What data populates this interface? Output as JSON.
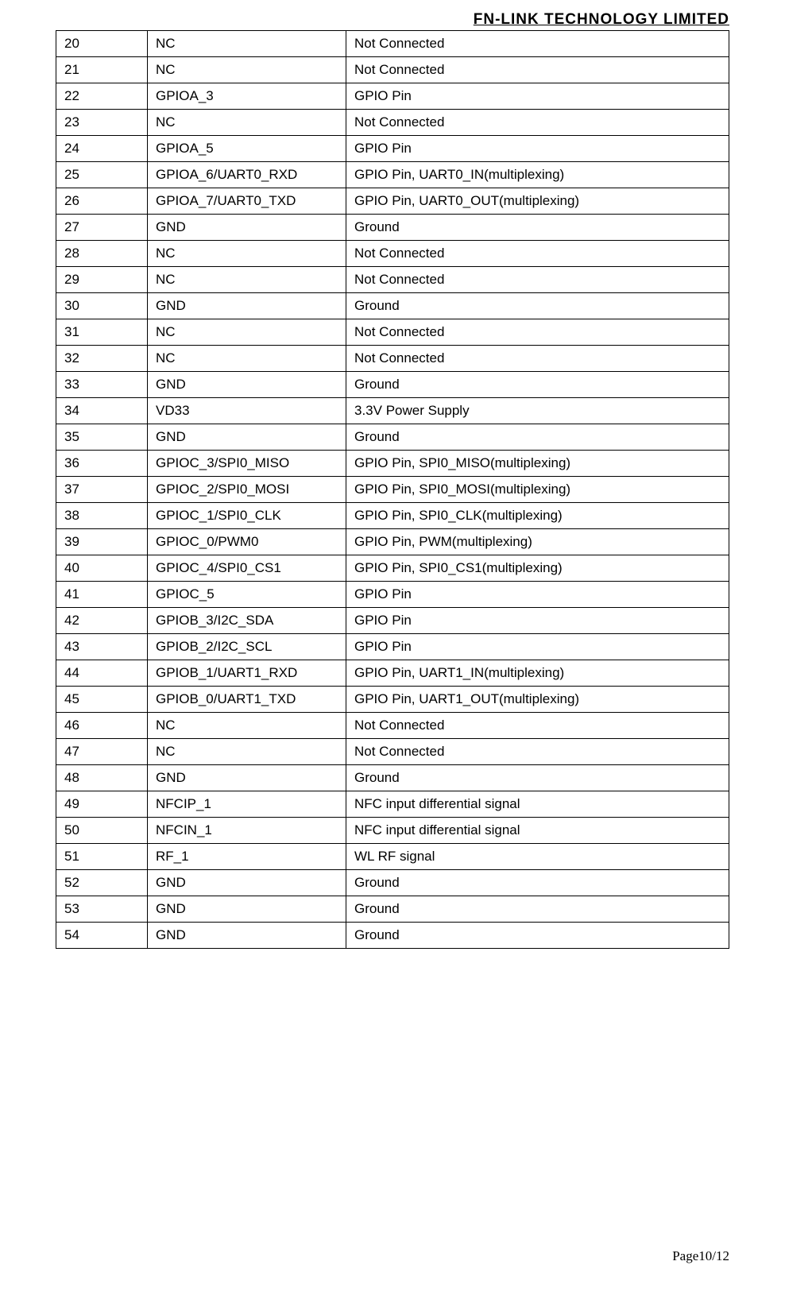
{
  "header": {
    "company": "FN-LINK TECHNOLOGY LIMITED"
  },
  "table": {
    "rows": [
      {
        "num": "20",
        "name": "NC",
        "desc": "Not Connected"
      },
      {
        "num": "21",
        "name": "NC",
        "desc": "Not Connected"
      },
      {
        "num": "22",
        "name": "GPIOA_3",
        "desc": "GPIO Pin"
      },
      {
        "num": "23",
        "name": "NC",
        "desc": "Not Connected"
      },
      {
        "num": "24",
        "name": "GPIOA_5",
        "desc": "GPIO Pin"
      },
      {
        "num": "25",
        "name": "GPIOA_6/UART0_RXD",
        "desc": "GPIO Pin, UART0_IN(multiplexing)"
      },
      {
        "num": "26",
        "name": "GPIOA_7/UART0_TXD",
        "desc": "GPIO Pin, UART0_OUT(multiplexing)"
      },
      {
        "num": "27",
        "name": "GND",
        "desc": "Ground"
      },
      {
        "num": "28",
        "name": "NC",
        "desc": "Not Connected"
      },
      {
        "num": "29",
        "name": "NC",
        "desc": "Not Connected"
      },
      {
        "num": "30",
        "name": "GND",
        "desc": "Ground"
      },
      {
        "num": "31",
        "name": "NC",
        "desc": "Not Connected"
      },
      {
        "num": "32",
        "name": "NC",
        "desc": "Not Connected"
      },
      {
        "num": "33",
        "name": "GND",
        "desc": "Ground"
      },
      {
        "num": "34",
        "name": "VD33",
        "desc": "3.3V Power Supply"
      },
      {
        "num": "35",
        "name": "GND",
        "desc": "Ground"
      },
      {
        "num": "36",
        "name": "GPIOC_3/SPI0_MISO",
        "desc": "GPIO Pin, SPI0_MISO(multiplexing)"
      },
      {
        "num": "37",
        "name": "GPIOC_2/SPI0_MOSI",
        "desc": "GPIO Pin, SPI0_MOSI(multiplexing)"
      },
      {
        "num": "38",
        "name": "GPIOC_1/SPI0_CLK",
        "desc": "GPIO Pin, SPI0_CLK(multiplexing)"
      },
      {
        "num": "39",
        "name": "GPIOC_0/PWM0",
        "desc": "GPIO Pin, PWM(multiplexing)"
      },
      {
        "num": "40",
        "name": "GPIOC_4/SPI0_CS1",
        "desc": "GPIO Pin, SPI0_CS1(multiplexing)"
      },
      {
        "num": "41",
        "name": "GPIOC_5",
        "desc": "GPIO Pin"
      },
      {
        "num": "42",
        "name": "GPIOB_3/I2C_SDA",
        "desc": "GPIO Pin"
      },
      {
        "num": "43",
        "name": "GPIOB_2/I2C_SCL",
        "desc": "GPIO Pin"
      },
      {
        "num": "44",
        "name": "GPIOB_1/UART1_RXD",
        "desc": "GPIO Pin, UART1_IN(multiplexing)"
      },
      {
        "num": "45",
        "name": "GPIOB_0/UART1_TXD",
        "desc": "GPIO Pin, UART1_OUT(multiplexing)"
      },
      {
        "num": "46",
        "name": "NC",
        "desc": "Not Connected"
      },
      {
        "num": "47",
        "name": "NC",
        "desc": "Not Connected"
      },
      {
        "num": "48",
        "name": "GND",
        "desc": "Ground"
      },
      {
        "num": "49",
        "name": "NFCIP_1",
        "desc": "NFC input differential signal"
      },
      {
        "num": "50",
        "name": "NFCIN_1",
        "desc": "NFC input differential signal"
      },
      {
        "num": "51",
        "name": "RF_1",
        "desc": "WL RF signal"
      },
      {
        "num": "52",
        "name": "GND",
        "desc": "Ground"
      },
      {
        "num": "53",
        "name": "GND",
        "desc": "Ground"
      },
      {
        "num": "54",
        "name": "GND",
        "desc": "Ground"
      }
    ]
  },
  "footer": {
    "page": "Page10/12"
  }
}
